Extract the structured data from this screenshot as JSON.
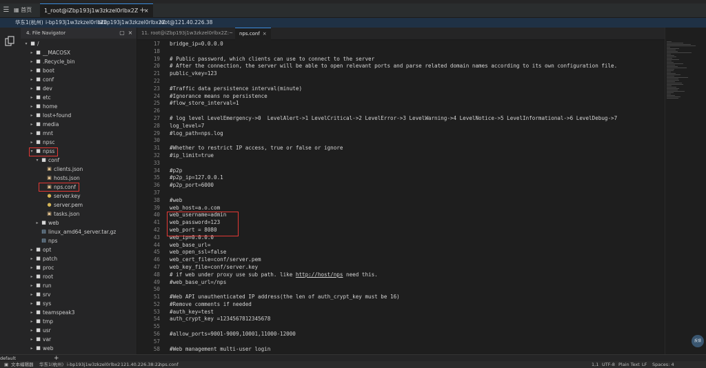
{
  "titlebar": {
    "home_label": "首页",
    "tab_label": "1_root@iZbp193j1w3zkzel0rlbx2Z"
  },
  "infobar": {
    "region": "华东1(杭州)",
    "instance": "i-bp193j1w3zkzel0rlbx2",
    "hostname": "iZbp193j1w3zkzel0rlbx2Z",
    "connection": "root@121.40.226.38"
  },
  "navigator": {
    "title": "4. File Navigator",
    "items": [
      {
        "label": "/",
        "depth": 0,
        "kind": "folder",
        "expanded": true
      },
      {
        "label": "__MACOSX",
        "depth": 1,
        "kind": "folder"
      },
      {
        "label": ".Recycle_bin",
        "depth": 1,
        "kind": "folder"
      },
      {
        "label": "boot",
        "depth": 1,
        "kind": "folder"
      },
      {
        "label": "conf",
        "depth": 1,
        "kind": "folder"
      },
      {
        "label": "dev",
        "depth": 1,
        "kind": "folder"
      },
      {
        "label": "etc",
        "depth": 1,
        "kind": "folder"
      },
      {
        "label": "home",
        "depth": 1,
        "kind": "folder"
      },
      {
        "label": "lost+found",
        "depth": 1,
        "kind": "folder"
      },
      {
        "label": "media",
        "depth": 1,
        "kind": "folder"
      },
      {
        "label": "mnt",
        "depth": 1,
        "kind": "folder"
      },
      {
        "label": "npsc",
        "depth": 1,
        "kind": "folder"
      },
      {
        "label": "npss",
        "depth": 1,
        "kind": "folder",
        "expanded": true,
        "highlight": true
      },
      {
        "label": "conf",
        "depth": 2,
        "kind": "folder",
        "expanded": true
      },
      {
        "label": "clients.json",
        "depth": 3,
        "kind": "json"
      },
      {
        "label": "hosts.json",
        "depth": 3,
        "kind": "json"
      },
      {
        "label": "nps.conf",
        "depth": 3,
        "kind": "json",
        "highlight": true
      },
      {
        "label": "server.key",
        "depth": 3,
        "kind": "key"
      },
      {
        "label": "server.pem",
        "depth": 3,
        "kind": "key"
      },
      {
        "label": "tasks.json",
        "depth": 3,
        "kind": "json"
      },
      {
        "label": "web",
        "depth": 2,
        "kind": "folder"
      },
      {
        "label": "linux_amd64_server.tar.gz",
        "depth": 2,
        "kind": "file"
      },
      {
        "label": "nps",
        "depth": 2,
        "kind": "file"
      },
      {
        "label": "opt",
        "depth": 1,
        "kind": "folder"
      },
      {
        "label": "patch",
        "depth": 1,
        "kind": "folder"
      },
      {
        "label": "proc",
        "depth": 1,
        "kind": "folder"
      },
      {
        "label": "root",
        "depth": 1,
        "kind": "folder"
      },
      {
        "label": "run",
        "depth": 1,
        "kind": "folder"
      },
      {
        "label": "srv",
        "depth": 1,
        "kind": "folder"
      },
      {
        "label": "sys",
        "depth": 1,
        "kind": "folder"
      },
      {
        "label": "teamspeak3",
        "depth": 1,
        "kind": "folder"
      },
      {
        "label": "tmp",
        "depth": 1,
        "kind": "folder"
      },
      {
        "label": "usr",
        "depth": 1,
        "kind": "folder"
      },
      {
        "label": "var",
        "depth": 1,
        "kind": "folder"
      },
      {
        "label": "web",
        "depth": 1,
        "kind": "folder"
      }
    ]
  },
  "editor": {
    "tabs": [
      {
        "label": "11. root@iZbp193j1w3zkzel0rlbx2Z:~",
        "active": false
      },
      {
        "label": "nps.conf",
        "active": true
      }
    ],
    "lines": [
      {
        "n": "17",
        "text": "bridge_ip=0.0.0.0"
      },
      {
        "n": "18",
        "text": ""
      },
      {
        "n": "19",
        "text": "# Public password, which clients can use to connect to the server"
      },
      {
        "n": "20",
        "text": "# After the connection, the server will be able to open relevant ports and parse related domain names according to its own configuration file."
      },
      {
        "n": "21",
        "text": "public_vkey=123"
      },
      {
        "n": "22",
        "text": ""
      },
      {
        "n": "23",
        "text": "#Traffic data persistence interval(minute)"
      },
      {
        "n": "24",
        "text": "#Ignorance means no persistence"
      },
      {
        "n": "25",
        "text": "#flow_store_interval=1"
      },
      {
        "n": "26",
        "text": ""
      },
      {
        "n": "27",
        "text": "# log level LevelEmergency->0  LevelAlert->1 LevelCritical->2 LevelError->3 LevelWarning->4 LevelNotice->5 LevelInformational->6 LevelDebug->7"
      },
      {
        "n": "28",
        "text": "log_level=7"
      },
      {
        "n": "29",
        "text": "#log_path=nps.log"
      },
      {
        "n": "30",
        "text": ""
      },
      {
        "n": "31",
        "text": "#Whether to restrict IP access, true or false or ignore"
      },
      {
        "n": "32",
        "text": "#ip_limit=true"
      },
      {
        "n": "33",
        "text": ""
      },
      {
        "n": "34",
        "text": "#p2p"
      },
      {
        "n": "35",
        "text": "#p2p_ip=127.0.0.1"
      },
      {
        "n": "36",
        "text": "#p2p_port=6000"
      },
      {
        "n": "37",
        "text": ""
      },
      {
        "n": "38",
        "text": "#web"
      },
      {
        "n": "39",
        "text": "web_host=a.o.com"
      },
      {
        "n": "40",
        "text": "web_username=admin"
      },
      {
        "n": "41",
        "text": "web_password=123"
      },
      {
        "n": "42",
        "text": "web_port = 8080"
      },
      {
        "n": "43",
        "text": "web_ip=0.0.0.0"
      },
      {
        "n": "44",
        "text": "web_base_url="
      },
      {
        "n": "45",
        "text": "web_open_ssl=false"
      },
      {
        "n": "46",
        "text": "web_cert_file=conf/server.pem"
      },
      {
        "n": "47",
        "text": "web_key_file=conf/server.key"
      },
      {
        "n": "48",
        "text": "# if web under proxy use sub path. like http://host/nps need this."
      },
      {
        "n": "49",
        "text": "#web_base_url=/nps"
      },
      {
        "n": "50",
        "text": ""
      },
      {
        "n": "51",
        "text": "#Web API unauthenticated IP address(the len of auth_crypt_key must be 16)"
      },
      {
        "n": "52",
        "text": "#Remove comments if needed"
      },
      {
        "n": "53",
        "text": "#auth_key=test"
      },
      {
        "n": "54",
        "text": "auth_crypt_key =1234567812345678"
      },
      {
        "n": "55",
        "text": ""
      },
      {
        "n": "56",
        "text": "#allow_ports=9001-9009,10001,11000-12000"
      },
      {
        "n": "57",
        "text": ""
      },
      {
        "n": "58",
        "text": "#Web management multi-user login"
      }
    ]
  },
  "panel": {
    "label": "default",
    "add_label": "+"
  },
  "statusbar": {
    "left": [
      "文本编辑器",
      "华东1(杭州)",
      "i-bp193j1w3zkzel0rlbx2",
      "121.40.226.38:22",
      "nps.conf"
    ],
    "right": [
      "1,1",
      "UTF-8",
      "Plain Text",
      "LF",
      "Spaces: 4"
    ]
  },
  "float_button": {
    "label": "反馈"
  }
}
